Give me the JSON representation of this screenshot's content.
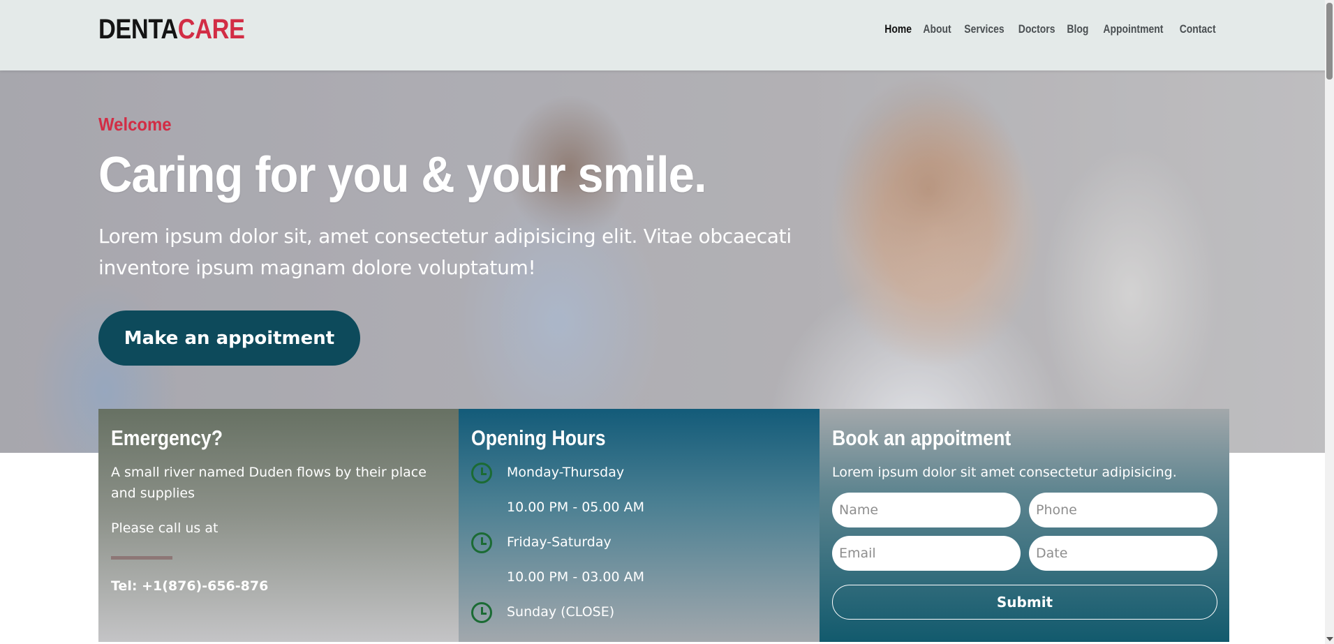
{
  "brand": {
    "part1": "DENTA",
    "part2": "CARE"
  },
  "nav": {
    "items": [
      {
        "label": "Home",
        "active": true
      },
      {
        "label": "About"
      },
      {
        "label": "Services"
      },
      {
        "label": "Doctors"
      },
      {
        "label": "Blog"
      },
      {
        "label": "Appointment"
      },
      {
        "label": "Contact"
      }
    ]
  },
  "hero": {
    "eyebrow": "Welcome",
    "title": "Caring for you & your smile.",
    "lead": "Lorem ipsum dolor sit, amet consectetur adipisicing elit. Vitae obcaecati inventore ipsum magnam dolore voluptatum!",
    "cta_label": "Make an appoitment"
  },
  "emergency": {
    "title": "Emergency?",
    "text": "A small river named Duden flows by their place and supplies",
    "call_text": "Please call us at",
    "tel": "Tel: +1(876)-656-876"
  },
  "hours": {
    "title": "Opening Hours",
    "days1": "Monday-Thursday",
    "time1": "10.00 PM - 05.00 AM",
    "days2": "Friday-Saturday",
    "time2": "10.00 PM - 03.00 AM",
    "days3": "Sunday (CLOSE)"
  },
  "book": {
    "title": "Book an appoitment",
    "text": "Lorem ipsum dolor sit amet consectetur adipisicing.",
    "name_placeholder": "Name",
    "phone_placeholder": "Phone",
    "email_placeholder": "Email",
    "date_placeholder": "Date",
    "submit_label": "Submit"
  },
  "colors": {
    "brand_dark": "#141414",
    "accent_red": "#d22d45",
    "primary_teal": "#0d4a5b",
    "clock_green": "#1b6b34"
  }
}
